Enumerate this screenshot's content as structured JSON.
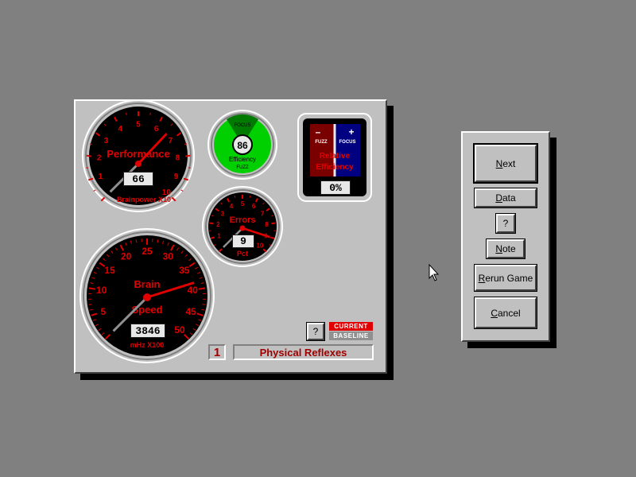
{
  "performance_gauge": {
    "title": "Performance",
    "subtitle": "Brainpower X10",
    "ticks": [
      "1",
      "2",
      "3",
      "4",
      "5",
      "6",
      "7",
      "8",
      "9",
      "10"
    ],
    "readout": "66",
    "value": 6.6
  },
  "efficiency_gauge": {
    "top_label": "FOCUS",
    "bottom_label": "FUZZ",
    "title": "Efficiency",
    "readout": "86",
    "value_percent": 86
  },
  "relative_efficiency": {
    "minus": "–",
    "plus": "+",
    "fuzz": "FUZZ",
    "focus": "FOCUS",
    "title_line1": "Relative",
    "title_line2": "Efficiency",
    "readout": "0%",
    "value_percent": 0,
    "fuzz_color": "#7a0000",
    "focus_color": "#000080"
  },
  "errors_gauge": {
    "title": "Errors",
    "subtitle": "Pct",
    "ticks": [
      "1",
      "2",
      "3",
      "4",
      "5",
      "6",
      "7",
      "8",
      "9",
      "10"
    ],
    "readout": "9",
    "value": 9
  },
  "brain_speed_gauge": {
    "title_line1": "Brain",
    "title_line2": "Speed",
    "subtitle": "mHz X100",
    "ticks": [
      "5",
      "10",
      "15",
      "20",
      "25",
      "30",
      "35",
      "40",
      "45",
      "50"
    ],
    "readout": "3846",
    "value": 38.46
  },
  "legend": {
    "current": "CURRENT",
    "baseline": "BASELINE",
    "current_color": "#e00000",
    "baseline_color": "#909090"
  },
  "help_button_dash": "?",
  "game_number": "1",
  "game_name": "Physical Reflexes",
  "side_panel": {
    "next": {
      "accel": "N",
      "rest": "ext"
    },
    "data": {
      "accel": "D",
      "rest": "ata"
    },
    "help": "?",
    "note": {
      "accel": "N",
      "rest": "ote"
    },
    "rerun": {
      "accel": "R",
      "rest": "erun Game"
    },
    "cancel": {
      "accel": "C",
      "rest": "ancel"
    }
  },
  "colors": {
    "gauge_red": "#e00000",
    "gauge_face": "#000000",
    "efficiency_green": "#00d000",
    "needle_current": "#e00000",
    "needle_baseline": "#909090"
  },
  "icons": [
    "mouse-pointer-icon"
  ]
}
